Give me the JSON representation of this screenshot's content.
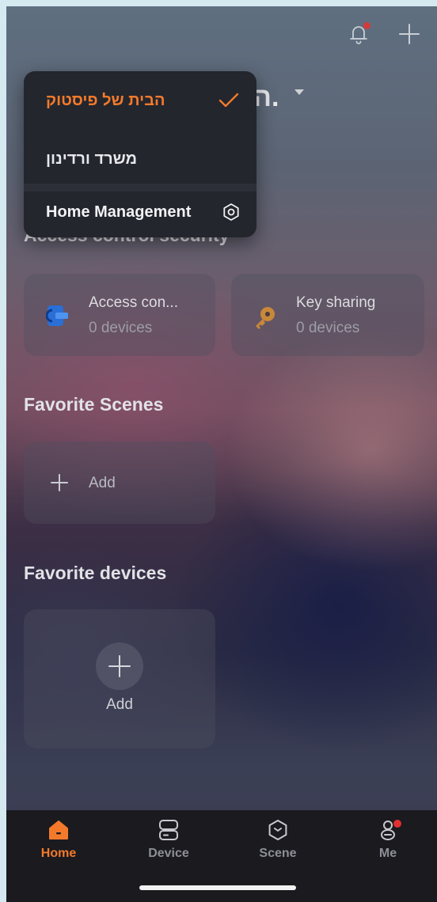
{
  "app": {
    "home_name_partial": "ה.",
    "colors": {
      "accent": "#f47a2b",
      "badge": "#d23b3b"
    }
  },
  "top_icons": [
    "bell-icon",
    "plus-icon"
  ],
  "dropdown": {
    "items": [
      {
        "label": "הבית של פיסטוק",
        "selected": true
      },
      {
        "label": "משרד ורדינון",
        "selected": false
      }
    ],
    "management_label": "Home Management"
  },
  "access_section": {
    "title": "Access control security",
    "cards": [
      {
        "label": "Access con...",
        "sub": "0 devices",
        "icon": "access-control-icon"
      },
      {
        "label": "Key sharing",
        "sub": "0 devices",
        "icon": "key-icon"
      }
    ]
  },
  "scenes_section": {
    "title": "Favorite Scenes",
    "add_label": "Add"
  },
  "devices_section": {
    "title": "Favorite devices",
    "add_label": "Add"
  },
  "tabs": [
    {
      "label": "Home",
      "icon": "home-icon",
      "active": true
    },
    {
      "label": "Device",
      "icon": "device-icon",
      "active": false
    },
    {
      "label": "Scene",
      "icon": "scene-icon",
      "active": false
    },
    {
      "label": "Me",
      "icon": "me-icon",
      "active": false,
      "badge": true
    }
  ]
}
